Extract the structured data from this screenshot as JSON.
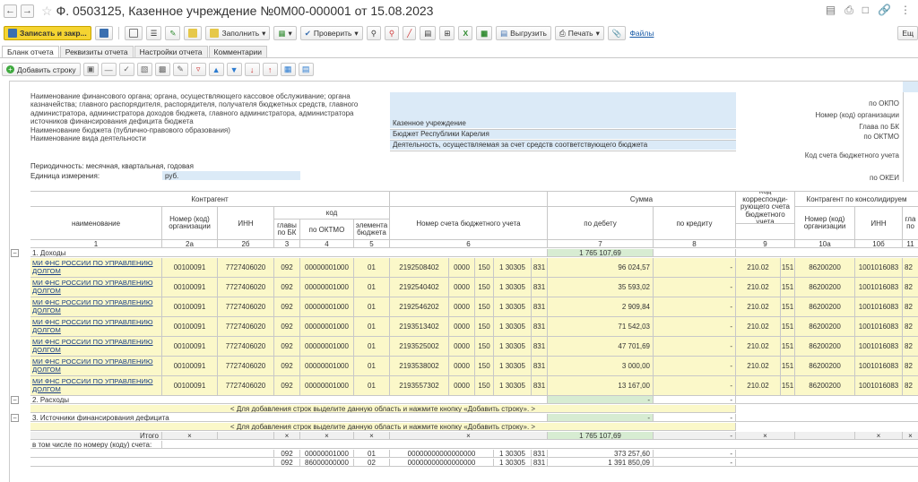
{
  "window": {
    "title": "Ф. 0503125, Казенное учреждение №0М00-000001 от 15.08.2023"
  },
  "toolbar": {
    "save_close": "Записать и закр...",
    "fill": "Заполнить",
    "check": "Проверить",
    "export": "Выгрузить",
    "print": "Печать",
    "files": "Файлы",
    "more": "Ещ"
  },
  "tabs": [
    "Бланк отчета",
    "Реквизиты отчета",
    "Настройки отчета",
    "Комментарии"
  ],
  "subtoolbar": {
    "add_row": "Добавить строку"
  },
  "header": {
    "left_text": "Наименование финансового органа; органа, осуществляющего кассовое обслуживание; органа казначейства; главного распорядителя, распорядителя, получателя бюджетных средств, главного администратора, администратора доходов бюджета, главного администратора, администратора источников финансирования дефицита бюджета",
    "budget_label": "Наименование бюджета (публично-правового образования)",
    "activity_label": "Наименование вида деятельности",
    "period_label": "Периодичность: месячная, квартальная, годовая",
    "unit_label": "Единица измерения:",
    "unit_value": "руб.",
    "org_value": "Казенное учреждение",
    "budget_value": "Бюджет Республики Карелия",
    "activity_value": "Деятельность, осуществляемая за счет средств соответствующего бюджета",
    "r_okpo": "по ОКПО",
    "r_org_code": "Номер (код) организации",
    "r_glava": "Глава по БК",
    "r_oktmo": "по ОКТМО",
    "r_account_code": "Код счета бюджетного учета",
    "r_okei": "по ОКЕИ"
  },
  "table": {
    "h_counterparty": "Контрагент",
    "h_name": "наименование",
    "h_number": "Номер (код) организации",
    "h_inn": "ИНН",
    "h_code": "код",
    "h_glava": "главы по БК",
    "h_oktmo": "по ОКТМО",
    "h_element": "элемента бюджета",
    "h_account": "Номер счета бюджетного учета",
    "h_sum": "Сумма",
    "h_debit": "по дебету",
    "h_credit": "по кредиту",
    "h_corr": "Код корреспонди-рующего счета бюджетного учета",
    "h_consol": "Контрагент по консолидируем",
    "h_cnumber": "Номер (код) организации",
    "h_cinn": "ИНН",
    "h_cglava": "гла по",
    "n_1": "1",
    "n_2a": "2а",
    "n_2b": "2б",
    "n_3": "3",
    "n_4": "4",
    "n_5": "5",
    "n_6": "6",
    "n_7": "7",
    "n_8": "8",
    "n_9": "9",
    "n_10a": "10а",
    "n_10b": "10б",
    "n_11": "11",
    "sec1": "1. Доходы",
    "sec1_total": "1 765 107,69",
    "sec2": "2. Расходы",
    "sec3": "3. Источники финансирования дефицита",
    "hint": "< Для добавления строк выделите данную область и нажмите кнопку «Добавить строку». >",
    "rows": [
      {
        "name": "МИ ФНС РОССИИ ПО УПРАВЛЕНИЮ ДОЛГОМ",
        "num": "00100091",
        "inn": "7727406020",
        "glava": "092",
        "oktmo": "00000001000",
        "el": "01",
        "a1": "2192508402",
        "a2": "0000",
        "a3": "150",
        "a4": "1 30305",
        "a5": "831",
        "debit": "96 024,57",
        "credit": "-",
        "c1": "210.02",
        "c2": "151",
        "cnum": "86200200",
        "cinn": "1001016083",
        "cg": "82"
      },
      {
        "name": "МИ ФНС РОССИИ ПО УПРАВЛЕНИЮ ДОЛГОМ",
        "num": "00100091",
        "inn": "7727406020",
        "glava": "092",
        "oktmo": "00000001000",
        "el": "01",
        "a1": "2192540402",
        "a2": "0000",
        "a3": "150",
        "a4": "1 30305",
        "a5": "831",
        "debit": "35 593,02",
        "credit": "-",
        "c1": "210.02",
        "c2": "151",
        "cnum": "86200200",
        "cinn": "1001016083",
        "cg": "82"
      },
      {
        "name": "МИ ФНС РОССИИ ПО УПРАВЛЕНИЮ ДОЛГОМ",
        "num": "00100091",
        "inn": "7727406020",
        "glava": "092",
        "oktmo": "00000001000",
        "el": "01",
        "a1": "2192546202",
        "a2": "0000",
        "a3": "150",
        "a4": "1 30305",
        "a5": "831",
        "debit": "2 909,84",
        "credit": "-",
        "c1": "210.02",
        "c2": "151",
        "cnum": "86200200",
        "cinn": "1001016083",
        "cg": "82"
      },
      {
        "name": "МИ ФНС РОССИИ ПО УПРАВЛЕНИЮ ДОЛГОМ",
        "num": "00100091",
        "inn": "7727406020",
        "glava": "092",
        "oktmo": "00000001000",
        "el": "01",
        "a1": "2193513402",
        "a2": "0000",
        "a3": "150",
        "a4": "1 30305",
        "a5": "831",
        "debit": "71 542,03",
        "credit": "-",
        "c1": "210.02",
        "c2": "151",
        "cnum": "86200200",
        "cinn": "1001016083",
        "cg": "82"
      },
      {
        "name": "МИ ФНС РОССИИ ПО УПРАВЛЕНИЮ ДОЛГОМ",
        "num": "00100091",
        "inn": "7727406020",
        "glava": "092",
        "oktmo": "00000001000",
        "el": "01",
        "a1": "2193525002",
        "a2": "0000",
        "a3": "150",
        "a4": "1 30305",
        "a5": "831",
        "debit": "47 701,69",
        "credit": "-",
        "c1": "210.02",
        "c2": "151",
        "cnum": "86200200",
        "cinn": "1001016083",
        "cg": "82"
      },
      {
        "name": "МИ ФНС РОССИИ ПО УПРАВЛЕНИЮ ДОЛГОМ",
        "num": "00100091",
        "inn": "7727406020",
        "glava": "092",
        "oktmo": "00000001000",
        "el": "01",
        "a1": "2193538002",
        "a2": "0000",
        "a3": "150",
        "a4": "1 30305",
        "a5": "831",
        "debit": "3 000,00",
        "credit": "-",
        "c1": "210.02",
        "c2": "151",
        "cnum": "86200200",
        "cinn": "1001016083",
        "cg": "82"
      },
      {
        "name": "МИ ФНС РОССИИ ПО УПРАВЛЕНИЮ ДОЛГОМ",
        "num": "00100091",
        "inn": "7727406020",
        "glava": "092",
        "oktmo": "00000001000",
        "el": "01",
        "a1": "2193557302",
        "a2": "0000",
        "a3": "150",
        "a4": "1 30305",
        "a5": "831",
        "debit": "13 167,00",
        "credit": "-",
        "c1": "210.02",
        "c2": "151",
        "cnum": "86200200",
        "cinn": "1001016083",
        "cg": "82"
      }
    ],
    "dash": "-",
    "x": "×",
    "total_label": "Итого",
    "total_debit": "1 765 107,69",
    "incl_label": "в том числе по номеру (коду) счета:",
    "incl_rows": [
      {
        "glava": "092",
        "oktmo": "00000001000",
        "el": "01",
        "acc": "00000000000000000",
        "a4": "1 30305",
        "a5": "831",
        "debit": "373 257,60"
      },
      {
        "glava": "092",
        "oktmo": "86000000000",
        "el": "02",
        "acc": "00000000000000000",
        "a4": "1 30305",
        "a5": "831",
        "debit": "1 391 850,09"
      }
    ]
  }
}
